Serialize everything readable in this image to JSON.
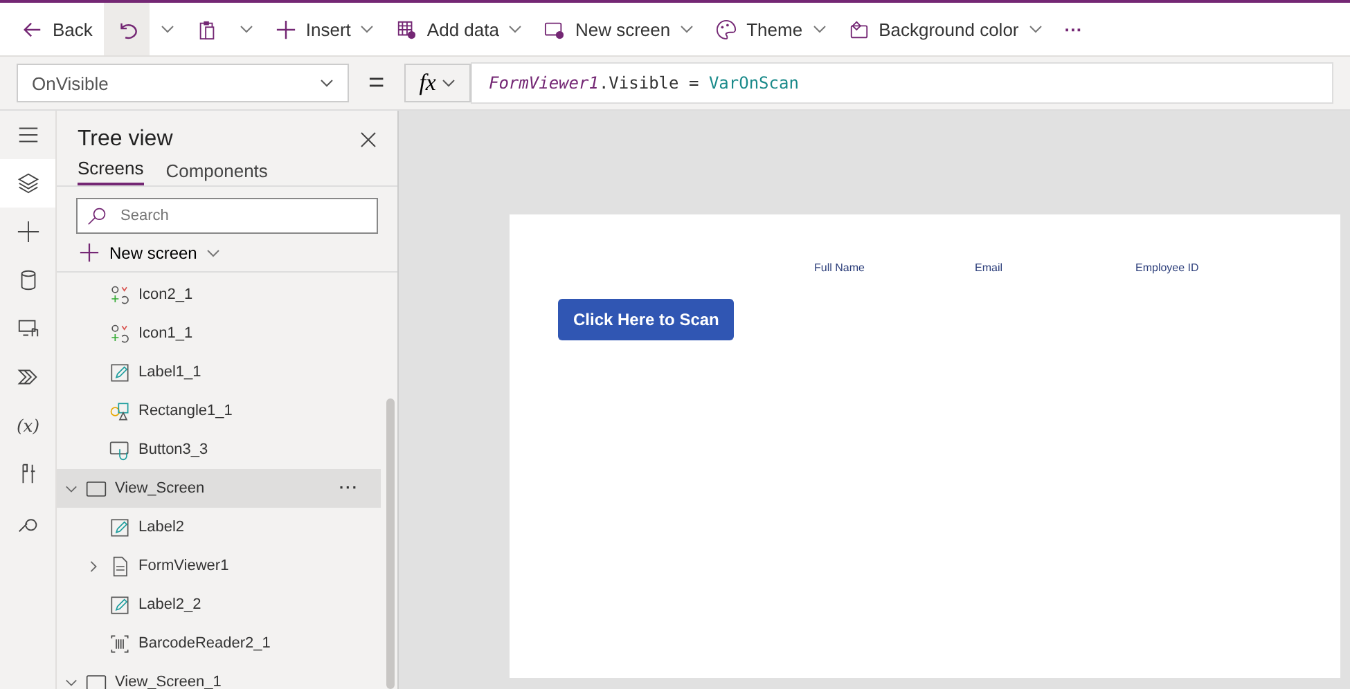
{
  "toolbar": {
    "items": [
      {
        "kind": "back",
        "label": "Back"
      },
      {
        "kind": "undo"
      },
      {
        "kind": "caret"
      },
      {
        "kind": "paste"
      },
      {
        "kind": "caret"
      },
      {
        "kind": "insert",
        "label": "Insert"
      },
      {
        "kind": "data",
        "label": "Add data"
      },
      {
        "kind": "screen",
        "label": "New screen"
      },
      {
        "kind": "theme",
        "label": "Theme"
      },
      {
        "kind": "bg",
        "label": "Background color"
      },
      {
        "kind": "more",
        "label": "···"
      }
    ]
  },
  "formula_bar": {
    "property": "OnVisible",
    "equals": "=",
    "fx": "fx",
    "formula": {
      "object": "FormViewer1",
      "member": ".Visible",
      "op": " = ",
      "value": "VarOnScan"
    }
  },
  "rail": [
    {
      "kind": "menu",
      "selected": false
    },
    {
      "kind": "layers",
      "selected": true
    },
    {
      "kind": "plus",
      "selected": false
    },
    {
      "kind": "db",
      "selected": false
    },
    {
      "kind": "media",
      "selected": false
    },
    {
      "kind": "flow",
      "selected": false
    },
    {
      "kind": "var",
      "glyph": "(x)",
      "selected": false
    },
    {
      "kind": "tools",
      "selected": false
    },
    {
      "kind": "search",
      "selected": false
    }
  ],
  "tree_view": {
    "title": "Tree view",
    "tabs": [
      {
        "label": "Screens",
        "selected": true
      },
      {
        "label": "Components",
        "selected": false
      }
    ],
    "search": {
      "placeholder": "Search"
    },
    "new_screen": "New screen",
    "items": [
      {
        "kind": "icon",
        "label": "Icon2_1"
      },
      {
        "kind": "icon",
        "label": "Icon1_1"
      },
      {
        "kind": "label",
        "label": "Label1_1"
      },
      {
        "kind": "shape",
        "label": "Rectangle1_1"
      },
      {
        "kind": "button",
        "label": "Button3_3"
      },
      {
        "kind": "screen",
        "label": "View_Screen",
        "expanded": true,
        "selected": true,
        "more": "···",
        "children": [
          {
            "kind": "label",
            "label": "Label2"
          },
          {
            "kind": "form",
            "label": "FormViewer1",
            "expanded": false
          },
          {
            "kind": "label",
            "label": "Label2_2"
          },
          {
            "kind": "barcode",
            "label": "BarcodeReader2_1"
          }
        ]
      },
      {
        "kind": "screen",
        "label": "View_Screen_1",
        "expanded": true,
        "selected": false
      }
    ]
  },
  "canvas": {
    "headers": [
      "Full Name",
      "Email",
      "Employee ID"
    ],
    "button": "Click Here to Scan"
  }
}
